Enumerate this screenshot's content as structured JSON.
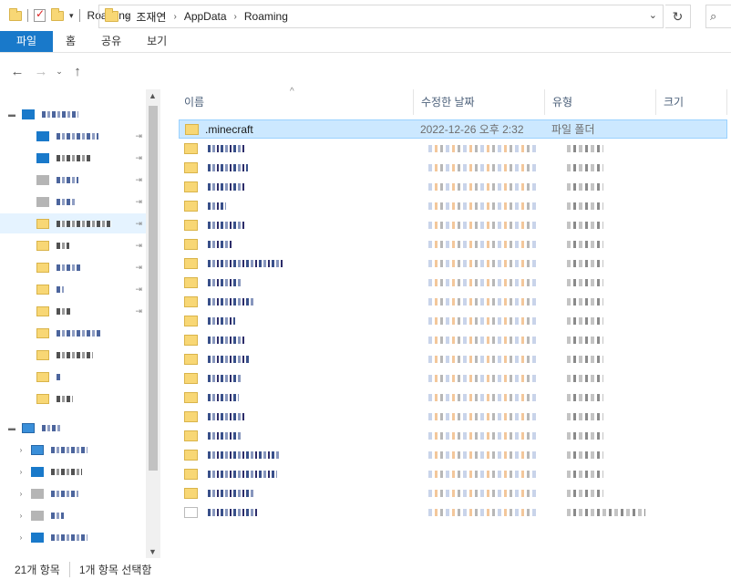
{
  "window": {
    "title": "Roaming"
  },
  "ribbon": {
    "tabs": [
      "파일",
      "홈",
      "공유",
      "보기"
    ]
  },
  "address": {
    "crumbs": [
      "조재연",
      "AppData",
      "Roaming"
    ],
    "search_icon": "search-icon"
  },
  "columns": {
    "name": "이름",
    "modified": "수정한 날짜",
    "type": "유형",
    "size": "크기"
  },
  "files": {
    "selected": {
      "name": ".minecraft",
      "modified": "2022-12-26 오후 2:32",
      "type": "파일 폴더"
    }
  },
  "status": {
    "count": "21개 항목",
    "selection": "1개 항목 선택함"
  }
}
